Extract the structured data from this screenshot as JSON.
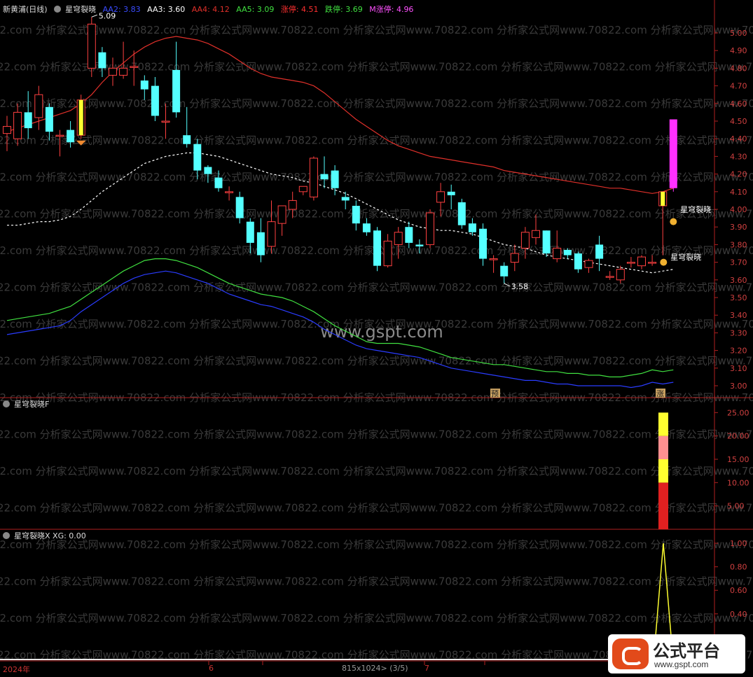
{
  "header": {
    "stock": "新黄浦(日线)",
    "indicator": "星穹裂晓",
    "aa2": "AA2: 3.83",
    "aa3": "AA3: 3.60",
    "aa4": "AA4: 4.12",
    "aa5": "AA5: 3.09",
    "zhangting": "涨停: 4.51",
    "dieting": "跌停: 3.69",
    "mzhangting": "M涨停: 4.96"
  },
  "panel2": {
    "title": "星穹裂晓F"
  },
  "panel3": {
    "title": "星穹裂晓X XG: 0.00"
  },
  "annotations": {
    "high": "5.09",
    "low": "3.58",
    "signal1": "星穹裂晓",
    "signal2": "星穹裂晓",
    "mark_yu": "预",
    "mark_zhang": "涨"
  },
  "watermark_center": "www.gspt.com",
  "watermark_repeat": "22.com 分析家公式网www.70822.com 分析家公式网www.70822.com 分析家公式网www.70822.com 分析家公式网www.70822.com 分析家公式网www.70822.com",
  "logo": {
    "title": "公式平台",
    "url": "www.gspt.com"
  },
  "bottom": {
    "year": "2024年",
    "m6": "6",
    "m7": "7",
    "status": "815x1024> (3/5)"
  },
  "colors": {
    "up": "#ff4040",
    "down": "#54ffff",
    "aa2": "#2a3cff",
    "aa4": "#e0302a",
    "aa5": "#40e040",
    "magenta": "#ff30ff",
    "yellow": "#ffff30",
    "axis": "#b02020"
  },
  "chart_data": [
    {
      "type": "candlestick",
      "title": "新黄浦(日线)",
      "ylim": [
        2.95,
        5.1
      ],
      "yticks": [
        "5.00",
        "4.90",
        "4.80",
        "4.70",
        "4.60",
        "4.50",
        "4.40",
        "4.30",
        "4.20",
        "4.10",
        "4.00",
        "3.90",
        "3.80",
        "3.70",
        "3.60",
        "3.50",
        "3.40",
        "3.30",
        "3.20",
        "3.10",
        "3.00"
      ],
      "ohlc": [
        [
          4.43,
          4.47,
          4.33,
          4.53
        ],
        [
          4.4,
          4.55,
          4.36,
          4.6
        ],
        [
          4.55,
          4.46,
          4.4,
          4.67
        ],
        [
          4.52,
          4.65,
          4.45,
          4.7
        ],
        [
          4.58,
          4.44,
          4.39,
          4.6
        ],
        [
          4.42,
          4.42,
          4.3,
          4.45
        ],
        [
          4.45,
          4.38,
          4.35,
          4.5
        ],
        [
          4.42,
          4.62,
          4.4,
          4.65
        ],
        [
          4.8,
          5.05,
          4.75,
          5.09
        ],
        [
          4.89,
          4.8,
          4.75,
          4.92
        ],
        [
          4.76,
          4.8,
          4.7,
          4.86
        ],
        [
          4.76,
          4.8,
          4.74,
          4.95
        ],
        [
          4.81,
          4.81,
          4.7,
          4.9
        ],
        [
          4.73,
          4.68,
          4.62,
          4.76
        ],
        [
          4.7,
          4.53,
          4.5,
          4.75
        ],
        [
          4.5,
          4.5,
          4.4,
          4.6
        ],
        [
          4.79,
          4.55,
          4.52,
          4.95
        ],
        [
          4.42,
          4.37,
          4.35,
          4.58
        ],
        [
          4.37,
          4.22,
          4.17,
          4.4
        ],
        [
          4.24,
          4.2,
          4.15,
          4.25
        ],
        [
          4.18,
          4.12,
          4.1,
          4.22
        ],
        [
          4.1,
          4.1,
          4.05,
          4.13
        ],
        [
          4.07,
          3.95,
          3.92,
          4.1
        ],
        [
          3.93,
          3.81,
          3.75,
          3.95
        ],
        [
          3.87,
          3.74,
          3.7,
          3.95
        ],
        [
          3.79,
          3.93,
          3.75,
          4.05
        ],
        [
          3.92,
          4.02,
          3.85,
          4.02
        ],
        [
          4.0,
          4.05,
          3.95,
          4.1
        ],
        [
          4.1,
          4.13,
          4.08,
          4.13
        ],
        [
          4.07,
          4.29,
          4.05,
          4.3
        ],
        [
          4.2,
          4.17,
          4.12,
          4.3
        ],
        [
          4.22,
          4.12,
          4.08,
          4.25
        ],
        [
          4.07,
          4.05,
          4.0,
          4.1
        ],
        [
          4.02,
          3.92,
          3.88,
          4.05
        ],
        [
          3.92,
          3.87,
          3.85,
          3.95
        ],
        [
          3.88,
          3.68,
          3.65,
          3.9
        ],
        [
          3.68,
          3.82,
          3.67,
          3.86
        ],
        [
          3.8,
          3.87,
          3.72,
          3.9
        ],
        [
          3.9,
          3.81,
          3.78,
          3.93
        ],
        [
          3.8,
          3.79,
          3.75,
          3.83
        ],
        [
          3.8,
          3.98,
          3.78,
          4.0
        ],
        [
          4.04,
          4.1,
          3.96,
          4.15
        ],
        [
          4.1,
          4.08,
          4.0,
          4.14
        ],
        [
          4.04,
          3.91,
          3.89,
          4.06
        ],
        [
          3.92,
          3.87,
          3.85,
          3.95
        ],
        [
          3.89,
          3.72,
          3.68,
          3.92
        ],
        [
          3.72,
          3.72,
          3.64,
          3.74
        ],
        [
          3.68,
          3.62,
          3.58,
          3.7
        ],
        [
          3.7,
          3.75,
          3.65,
          3.8
        ],
        [
          3.78,
          3.87,
          3.72,
          3.9
        ],
        [
          3.84,
          3.88,
          3.8,
          3.97
        ],
        [
          3.88,
          3.75,
          3.73,
          3.88
        ],
        [
          3.72,
          3.78,
          3.7,
          3.88
        ],
        [
          3.77,
          3.74,
          3.72,
          3.78
        ],
        [
          3.75,
          3.66,
          3.64,
          3.76
        ],
        [
          3.67,
          3.71,
          3.64,
          3.72
        ],
        [
          3.8,
          3.72,
          3.65,
          3.85
        ],
        [
          3.62,
          3.62,
          3.6,
          3.65
        ],
        [
          3.6,
          3.66,
          3.58,
          3.68
        ],
        [
          3.7,
          3.7,
          3.67,
          3.73
        ],
        [
          3.68,
          3.73,
          3.66,
          3.74
        ],
        [
          3.7,
          3.7,
          3.68,
          3.74
        ],
        [
          4.02,
          4.1,
          3.74,
          4.1
        ],
        [
          4.12,
          4.51,
          4.1,
          4.51
        ]
      ],
      "ma_dashed": [
        3.91,
        3.91,
        3.92,
        3.93,
        3.93,
        3.94,
        3.96,
        4.0,
        4.05,
        4.1,
        4.14,
        4.18,
        4.22,
        4.26,
        4.28,
        4.3,
        4.31,
        4.32,
        4.32,
        4.31,
        4.3,
        4.28,
        4.26,
        4.24,
        4.22,
        4.2,
        4.19,
        4.18,
        4.16,
        4.15,
        4.13,
        4.11,
        4.09,
        4.06,
        4.03,
        4.0,
        3.97,
        3.94,
        3.92,
        3.9,
        3.89,
        3.88,
        3.88,
        3.87,
        3.86,
        3.84,
        3.82,
        3.8,
        3.79,
        3.78,
        3.76,
        3.74,
        3.73,
        3.72,
        3.71,
        3.7,
        3.69,
        3.68,
        3.67,
        3.66,
        3.65,
        3.64,
        3.65,
        3.66
      ],
      "aa4": [
        4.44,
        4.46,
        4.48,
        4.5,
        4.52,
        4.54,
        4.56,
        4.6,
        4.65,
        4.72,
        4.78,
        4.83,
        4.88,
        4.92,
        4.95,
        4.97,
        4.98,
        4.97,
        4.96,
        4.94,
        4.91,
        4.88,
        4.84,
        4.8,
        4.77,
        4.75,
        4.74,
        4.73,
        4.72,
        4.7,
        4.66,
        4.61,
        4.56,
        4.51,
        4.47,
        4.43,
        4.39,
        4.36,
        4.34,
        4.32,
        4.3,
        4.29,
        4.28,
        4.27,
        4.26,
        4.25,
        4.24,
        4.22,
        4.21,
        4.2,
        4.19,
        4.18,
        4.17,
        4.16,
        4.15,
        4.14,
        4.13,
        4.12,
        4.12,
        4.11,
        4.1,
        4.09,
        4.1,
        4.12
      ],
      "aa5": [
        3.37,
        3.38,
        3.39,
        3.4,
        3.41,
        3.43,
        3.45,
        3.49,
        3.53,
        3.57,
        3.61,
        3.65,
        3.68,
        3.71,
        3.72,
        3.72,
        3.71,
        3.69,
        3.67,
        3.64,
        3.61,
        3.58,
        3.56,
        3.54,
        3.52,
        3.51,
        3.5,
        3.48,
        3.45,
        3.42,
        3.38,
        3.34,
        3.31,
        3.28,
        3.25,
        3.24,
        3.24,
        3.24,
        3.23,
        3.22,
        3.2,
        3.18,
        3.16,
        3.15,
        3.14,
        3.13,
        3.12,
        3.12,
        3.11,
        3.1,
        3.09,
        3.08,
        3.08,
        3.07,
        3.07,
        3.06,
        3.06,
        3.05,
        3.05,
        3.06,
        3.07,
        3.09,
        3.08,
        3.09
      ],
      "aa2": [
        3.29,
        3.3,
        3.31,
        3.32,
        3.33,
        3.34,
        3.37,
        3.42,
        3.46,
        3.5,
        3.54,
        3.58,
        3.61,
        3.63,
        3.64,
        3.65,
        3.64,
        3.62,
        3.6,
        3.58,
        3.55,
        3.52,
        3.5,
        3.48,
        3.46,
        3.45,
        3.43,
        3.41,
        3.39,
        3.36,
        3.32,
        3.29,
        3.26,
        3.23,
        3.21,
        3.2,
        3.19,
        3.18,
        3.17,
        3.16,
        3.14,
        3.12,
        3.1,
        3.09,
        3.08,
        3.07,
        3.06,
        3.05,
        3.04,
        3.03,
        3.03,
        3.02,
        3.01,
        3.01,
        3.0,
        3.0,
        3.0,
        3.0,
        3.0,
        2.99,
        3.0,
        3.02,
        3.01,
        3.02
      ]
    },
    {
      "type": "bar",
      "title": "星穹裂晓F",
      "ylim": [
        0,
        27
      ],
      "yticks": [
        "25.00",
        "20.00",
        "15.00",
        "10.00",
        "5.00"
      ],
      "last_bar_segments": [
        {
          "from": 0,
          "to": 10,
          "color": "#e02020"
        },
        {
          "from": 10,
          "to": 15,
          "color": "#ffff30"
        },
        {
          "from": 15,
          "to": 20,
          "color": "#ff9090"
        },
        {
          "from": 20,
          "to": 25,
          "color": "#ffff30"
        }
      ]
    },
    {
      "type": "line",
      "title": "星穹裂晓X XG: 0.00",
      "ylim": [
        0.28,
        1.05
      ],
      "yticks": [
        "1.00",
        "0.80",
        "0.60",
        "0.40"
      ],
      "series": [
        {
          "values": [
            0,
            1,
            0
          ]
        }
      ]
    }
  ]
}
